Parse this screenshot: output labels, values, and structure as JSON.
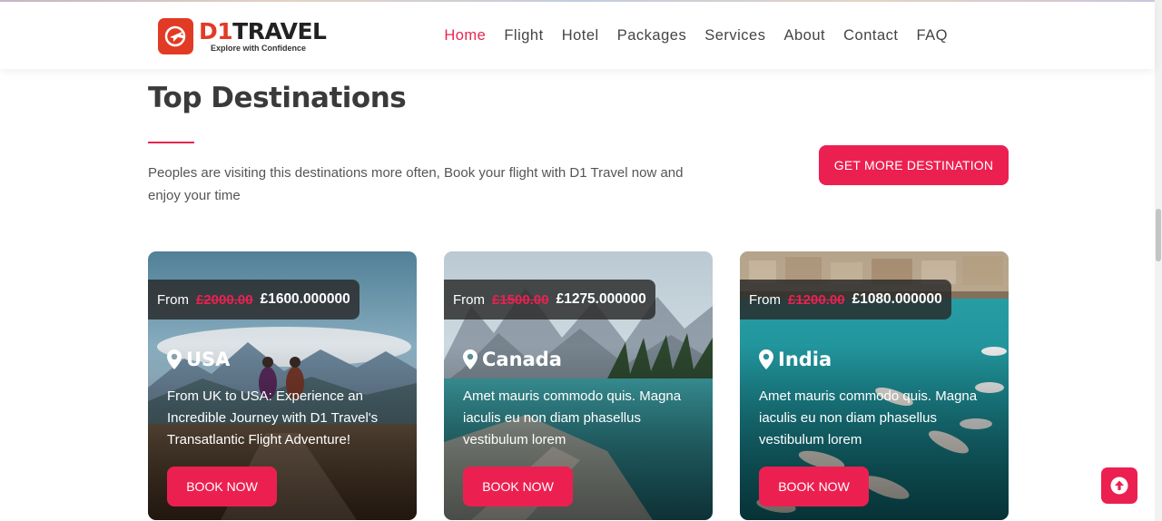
{
  "brand": {
    "name_prefix": "D1",
    "name_suffix": "TRAVEL",
    "tagline": "Explore with Confidence",
    "accent_color": "#ec2050",
    "logo_color": "#e23b25"
  },
  "nav": {
    "items": [
      "Home",
      "Flight",
      "Hotel",
      "Packages",
      "Services",
      "About",
      "Contact",
      "FAQ"
    ],
    "active": "Home"
  },
  "section": {
    "title": "Top Destinations",
    "description": "Peoples are visiting this destinations more often, Book your flight with D1 Travel now and enjoy your time",
    "more_button": "GET MORE DESTINATION"
  },
  "destinations": [
    {
      "name": "USA",
      "from_label": "From",
      "old_price": "£2000.00",
      "new_price": "£1600.000000",
      "description": "From UK to USA: Experience an Incredible Journey with D1 Travel's Transatlantic Flight Adventure!",
      "button": "BOOK NOW"
    },
    {
      "name": "Canada",
      "from_label": "From",
      "old_price": "£1500.00",
      "new_price": "£1275.000000",
      "description": "Amet mauris commodo quis. Magna iaculis eu non diam phasellus vestibulum lorem",
      "button": "BOOK NOW"
    },
    {
      "name": "India",
      "from_label": "From",
      "old_price": "£1200.00",
      "new_price": "£1080.000000",
      "description": "Amet mauris commodo quis. Magna iaculis eu non diam phasellus vestibulum lorem",
      "button": "BOOK NOW"
    }
  ],
  "icons": {
    "pin": "map-pin-icon",
    "scroll_top": "arrow-up-icon",
    "logo": "plane-logo-icon"
  }
}
